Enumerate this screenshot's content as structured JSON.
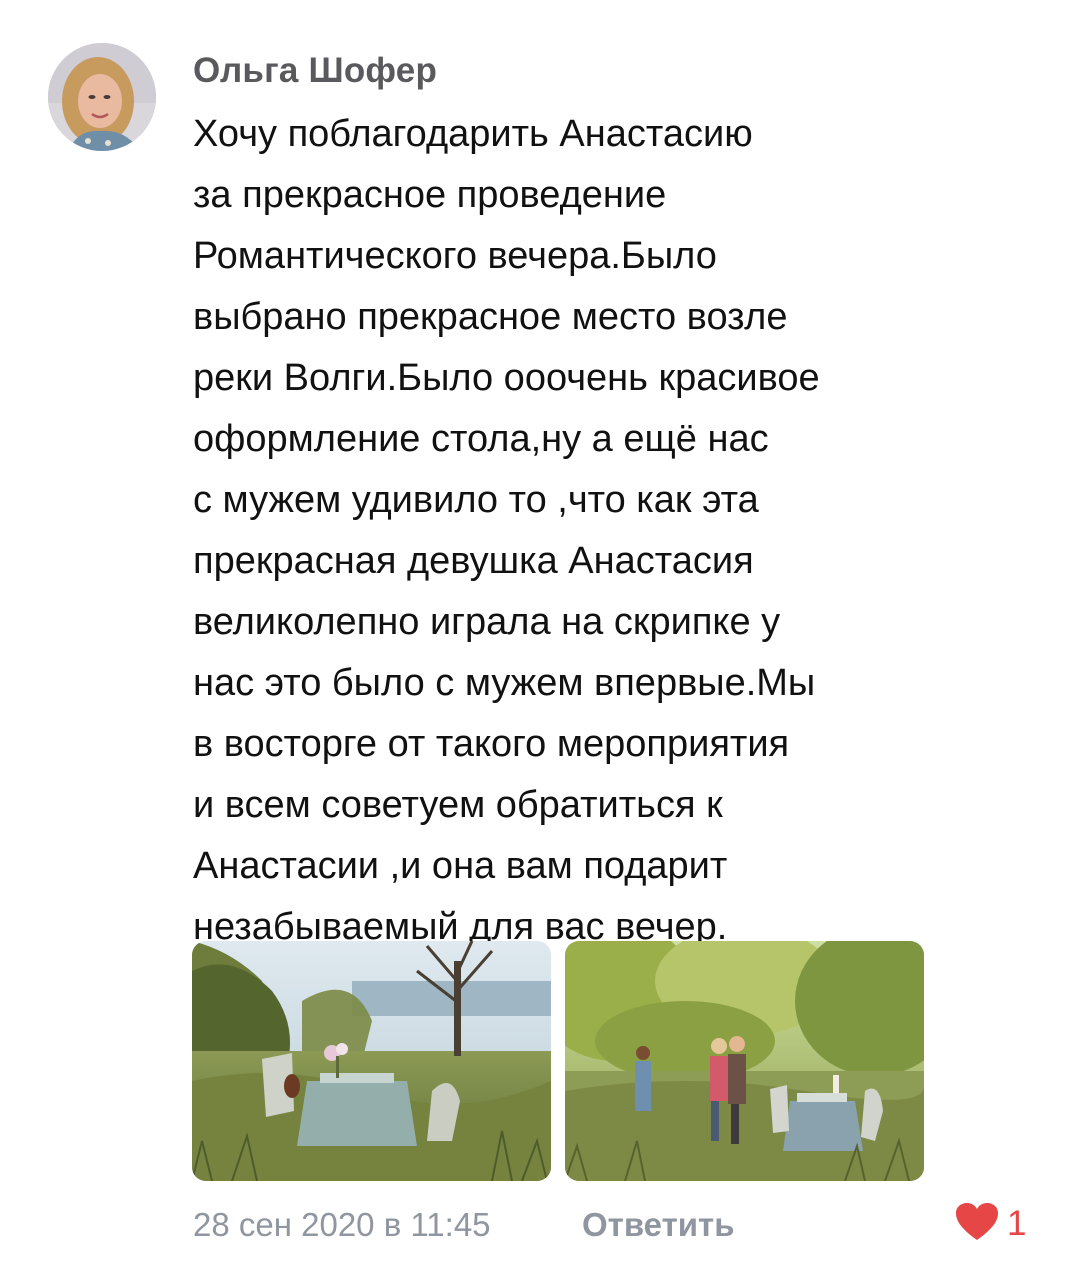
{
  "comment": {
    "author": "Ольга Шофер",
    "lines": [
      "Хочу поблагодарить Анастасию",
      "за прекрасное проведение",
      "Романтического вечера.Было",
      "выбрано прекрасное место возле",
      "реки Волги.Было ооочень красивое",
      "оформление стола,ну а ещё нас",
      "с мужем удивило то ,что как эта",
      "прекрасная девушка Анастасия",
      "великолепно играла на скрипке у",
      "нас это было с мужем впервые.Мы",
      "в восторге от такого мероприятия",
      "и всем советуем обратиться к",
      "Анастасии ,и она вам подарит",
      "незабываемый для вас вечер."
    ],
    "attachments": [
      {
        "icon": "photo-riverside-table"
      },
      {
        "icon": "photo-violinist-couple"
      }
    ],
    "footer": {
      "date": "28 сен 2020 в 11:45",
      "reply_label": "Ответить",
      "like_icon": "heart-icon",
      "like_count": "1",
      "like_color": "#e64646"
    }
  },
  "colors": {
    "author": "#5a5a5e",
    "text": "#111111",
    "meta": "#8f96a0",
    "accent": "#e64646"
  }
}
